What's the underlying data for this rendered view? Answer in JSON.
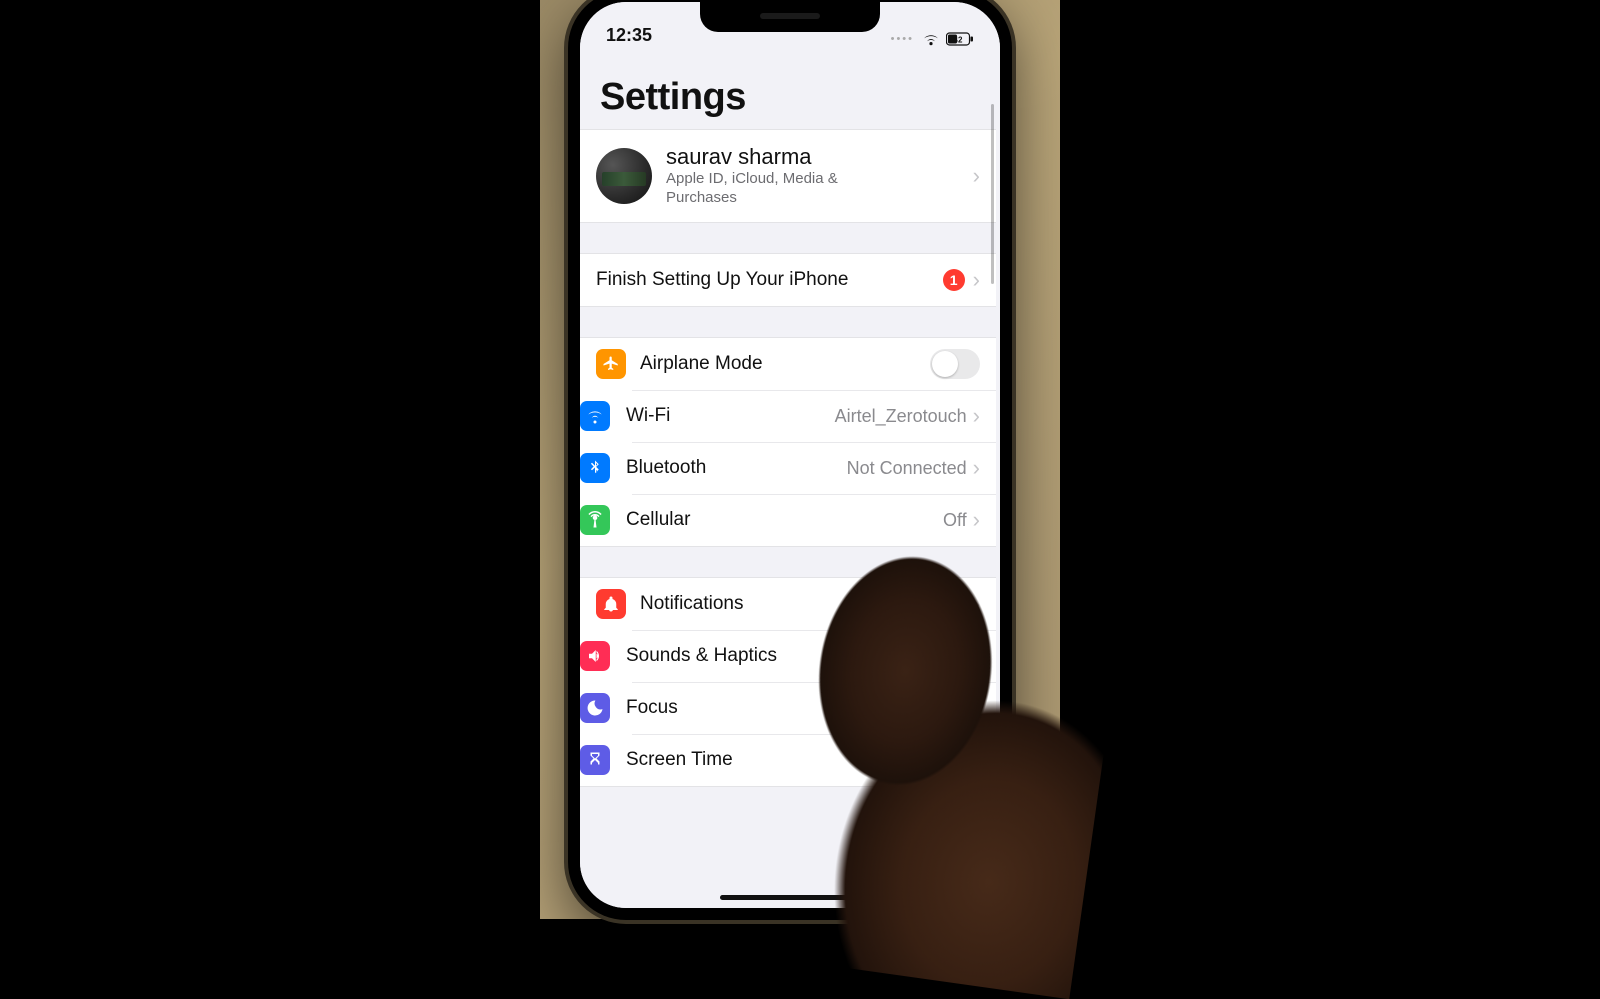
{
  "status": {
    "time": "12:35",
    "battery": "42"
  },
  "page_title": "Settings",
  "profile": {
    "name": "saurav sharma",
    "subtitle": "Apple ID, iCloud, Media & Purchases"
  },
  "finish_setup": {
    "label": "Finish Setting Up Your iPhone",
    "badge": "1"
  },
  "items": {
    "airplane": {
      "label": "Airplane Mode",
      "toggle_on": false
    },
    "wifi": {
      "label": "Wi-Fi",
      "value": "Airtel_Zerotouch"
    },
    "bluetooth": {
      "label": "Bluetooth",
      "value": "Not Connected"
    },
    "cellular": {
      "label": "Cellular",
      "value": "Off"
    },
    "notifications": {
      "label": "Notifications"
    },
    "sounds": {
      "label": "Sounds & Haptics"
    },
    "focus": {
      "label": "Focus"
    },
    "screentime": {
      "label": "Screen Time"
    }
  }
}
